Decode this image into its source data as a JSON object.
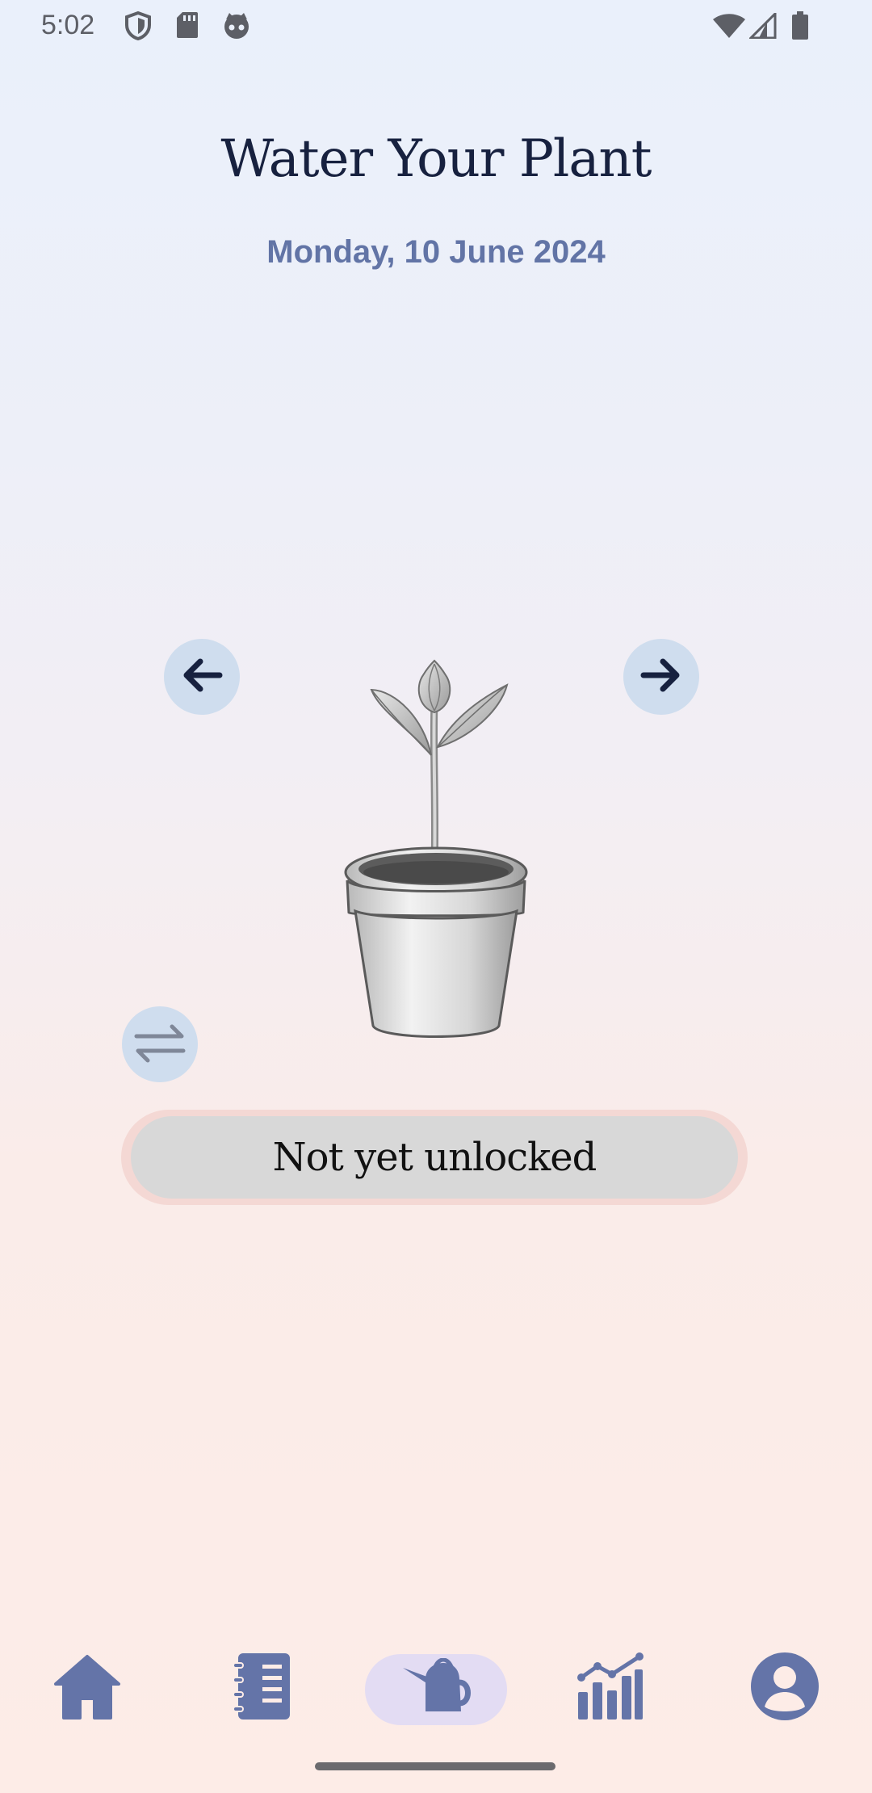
{
  "status_bar": {
    "time": "5:02",
    "left_icons": [
      "shield-icon",
      "sd-card-icon",
      "cat-face-icon"
    ],
    "right_icons": [
      "wifi-icon",
      "signal-icon",
      "battery-icon"
    ]
  },
  "header": {
    "title": "Water Your Plant",
    "date": "Monday, 10 June 2024"
  },
  "controls": {
    "prev_icon": "arrow-left-icon",
    "next_icon": "arrow-right-icon",
    "swap_icon": "swap-arrows-icon"
  },
  "plant": {
    "image": "potted-seedling-illustration"
  },
  "unlock_button": {
    "label": "Not yet unlocked"
  },
  "bottom_nav": {
    "items": [
      {
        "icon": "home-icon",
        "active": false
      },
      {
        "icon": "journal-icon",
        "active": false
      },
      {
        "icon": "watering-can-icon",
        "active": true
      },
      {
        "icon": "stats-chart-icon",
        "active": false
      },
      {
        "icon": "account-icon",
        "active": false
      }
    ]
  },
  "colors": {
    "accent": "#6274a6",
    "title": "#17213f",
    "button_bg": "#cfddee",
    "active_pill": "#e3dcf3"
  }
}
